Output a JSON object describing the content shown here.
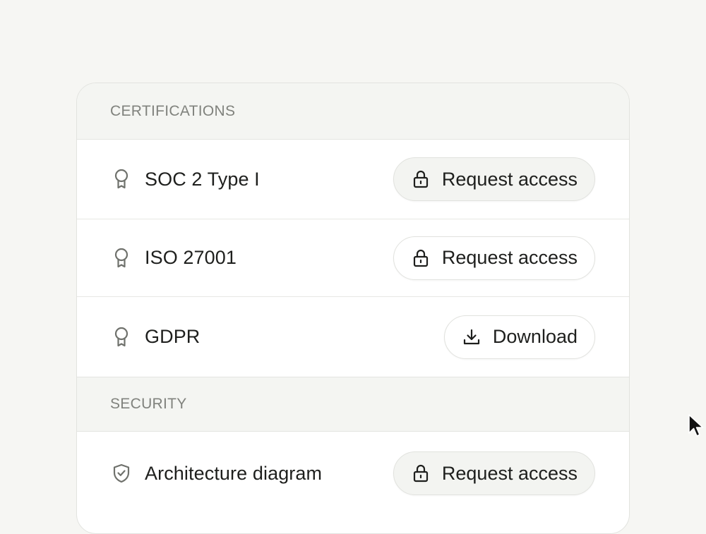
{
  "sections": [
    {
      "title": "CERTIFICATIONS",
      "items": [
        {
          "label": "SOC 2 Type I",
          "icon": "award-ribbon-icon",
          "action": {
            "label": "Request access",
            "icon": "lock-icon"
          }
        },
        {
          "label": "ISO 27001",
          "icon": "award-ribbon-icon",
          "action": {
            "label": "Request access",
            "icon": "lock-icon"
          }
        },
        {
          "label": "GDPR",
          "icon": "award-ribbon-icon",
          "action": {
            "label": "Download",
            "icon": "download-icon"
          }
        }
      ]
    },
    {
      "title": "SECURITY",
      "items": [
        {
          "label": "Architecture diagram",
          "icon": "shield-check-icon",
          "action": {
            "label": "Request access",
            "icon": "lock-icon"
          }
        }
      ]
    }
  ],
  "colors": {
    "page_background": "#f6f6f3",
    "card_background": "#ffffff",
    "section_header_background": "#f4f5f2",
    "muted_text": "#80827d",
    "primary_text": "#1e1f1d",
    "border": "#e2e3df"
  }
}
